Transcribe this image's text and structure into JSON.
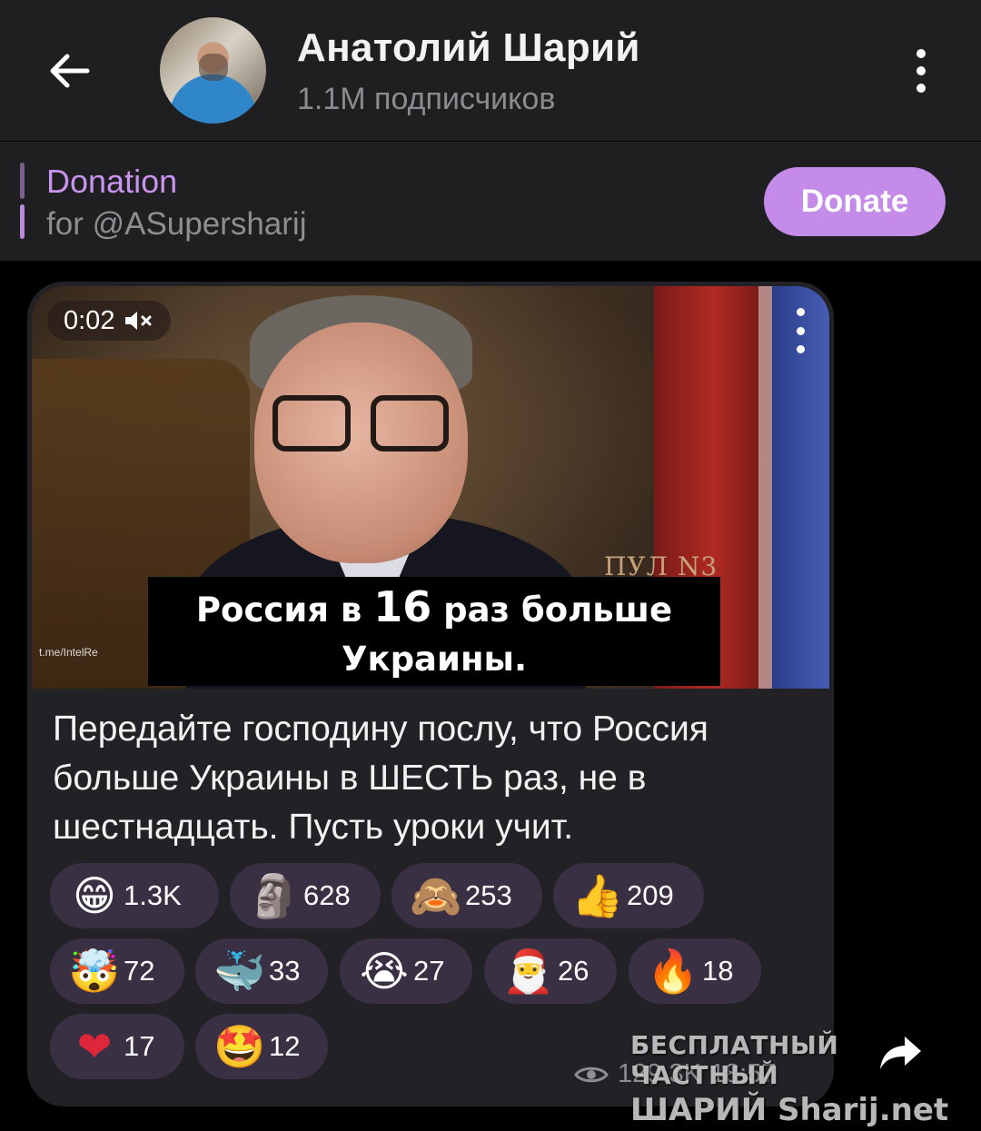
{
  "header": {
    "title": "Анатолий Шарий",
    "subscribers": "1.1M подписчиков",
    "back_icon": "arrow-left-icon",
    "menu_icon": "more-vertical-icon"
  },
  "pinned": {
    "title": "Donation",
    "subtitle": "for @ASupersharij",
    "button_label": "Donate",
    "accent_color": "#c48be9"
  },
  "video": {
    "duration": "0:02",
    "mute_icon": "speaker-muted-icon",
    "caption_prefix": "Россия в ",
    "caption_number": "16",
    "caption_suffix": " раз больше",
    "caption_line2": "Украины.",
    "watermark_channel": "ПУЛ N3",
    "watermark_link": "t.me/IntelRe"
  },
  "message": {
    "text": "Передайте господину послу, что Россия больше Украины в ШЕСТЬ раз, не в шестнадцать. Пусть уроки учит.",
    "views": "129.3K",
    "time": "18:57"
  },
  "reactions": [
    {
      "emoji": "😁",
      "count": "1.3K"
    },
    {
      "emoji": "🗿",
      "count": "628"
    },
    {
      "emoji": "🙈",
      "count": "253"
    },
    {
      "emoji": "👍",
      "count": "209"
    },
    {
      "emoji": "🤯",
      "count": "72"
    },
    {
      "emoji": "🐳",
      "count": "33"
    },
    {
      "emoji": "😭",
      "count": "27"
    },
    {
      "emoji": "🎅",
      "count": "26"
    },
    {
      "emoji": "🔥",
      "count": "18"
    },
    {
      "emoji": "❤",
      "count": "17"
    },
    {
      "emoji": "🤩",
      "count": "12"
    }
  ],
  "site_watermark": {
    "line1": "БЕСПЛАТНЫЙ ЧАСТНЫЙ",
    "line2": "ШАРИЙ Sharij.net"
  }
}
